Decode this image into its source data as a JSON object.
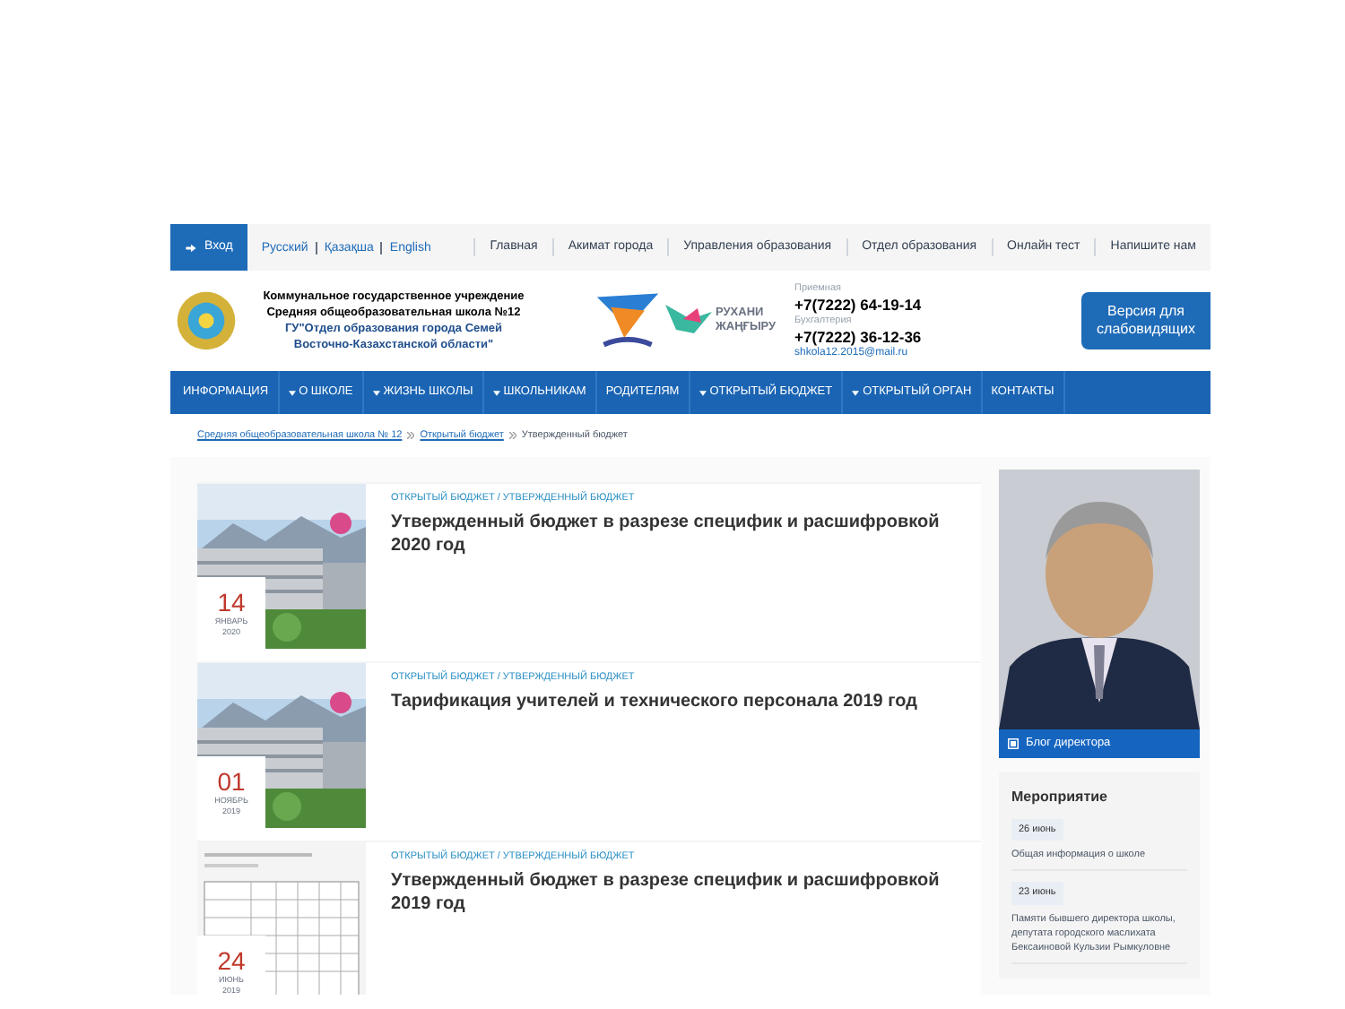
{
  "topbar": {
    "login": "Вход",
    "languages": [
      "Русский",
      "Қазақша",
      "English"
    ],
    "links": [
      "Главная",
      "Акимат города",
      "Управления образования",
      "Отдел образования",
      "Онлайн тест",
      "Напишите нам"
    ]
  },
  "header": {
    "org_lines": [
      "Коммунальное государственное учреждение",
      "Средняя общеобразовательная школа №12"
    ],
    "dept_lines": [
      "ГУ\"Отдел образования города Семей",
      "Восточно-Казахстанской области\""
    ],
    "logo_text": "РУХАНИ ЖАҢҒЫРУ",
    "reception_label": "Приемная",
    "reception_phone": "+7(7222) 64-19-14",
    "accounting_label": "Бухгалтерия",
    "accounting_phone": "+7(7222) 36-12-36",
    "email": "shkola12.2015@mail.ru",
    "accessibility_button": "Версия для слабовидящих"
  },
  "nav": [
    {
      "label": "ИНФОРМАЦИЯ",
      "dropdown": false
    },
    {
      "label": "О ШКОЛЕ",
      "dropdown": true
    },
    {
      "label": "ЖИЗНЬ ШКОЛЫ",
      "dropdown": true
    },
    {
      "label": "ШКОЛЬНИКАМ",
      "dropdown": true
    },
    {
      "label": "РОДИТЕЛЯМ",
      "dropdown": false
    },
    {
      "label": "ОТКРЫТЫЙ БЮДЖЕТ",
      "dropdown": true
    },
    {
      "label": "ОТКРЫТЫЙ ОРГАН",
      "dropdown": true
    },
    {
      "label": "КОНТАКТЫ",
      "dropdown": false
    }
  ],
  "breadcrumb": [
    "Средняя общеобразовательная школа № 12",
    "Открытый бюджет",
    "Утвержденный бюджет"
  ],
  "posts": [
    {
      "kind": "building",
      "category": "ОТКРЫТЫЙ БЮДЖЕТ / УТВЕРЖДЕННЫЙ БЮДЖЕТ",
      "title": "Утвержденный бюджет в разрезе специфик и расшифровкой 2020 год",
      "day": "14",
      "month": "ЯНВАРЬ",
      "year": "2020"
    },
    {
      "kind": "building",
      "category": "ОТКРЫТЫЙ БЮДЖЕТ / УТВЕРЖДЕННЫЙ БЮДЖЕТ",
      "title": "Тарификация учителей и технического персонала 2019 год",
      "day": "01",
      "month": "НОЯБРЬ",
      "year": "2019"
    },
    {
      "kind": "document",
      "category": "ОТКРЫТЫЙ БЮДЖЕТ / УТВЕРЖДЕННЫЙ БЮДЖЕТ",
      "title": "Утвержденный бюджет в разрезе специфик и расшифровкой 2019 год",
      "day": "24",
      "month": "ИЮНЬ",
      "year": "2019"
    }
  ],
  "sidebar": {
    "director_link": "Блог директора",
    "events_title": "Мероприятие",
    "events": [
      {
        "date": "26 июнь",
        "text": "Общая информация о школе"
      },
      {
        "date": "23 июнь",
        "text": "Памяти бывшего директора школы, депутата городского маслихата Бексаиновой Кульзии Рымкуловне"
      }
    ]
  }
}
